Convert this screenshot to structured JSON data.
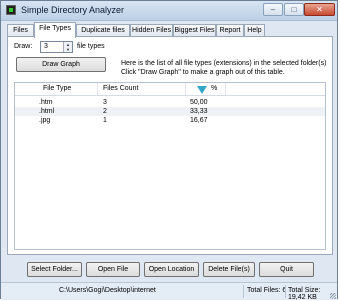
{
  "window": {
    "title": "Simple Directory Analyzer"
  },
  "titlebar_buttons": {
    "minimize": "–",
    "maximize": "□",
    "close": "✕"
  },
  "tabs": [
    {
      "label": "Files"
    },
    {
      "label": "File Types",
      "active": true
    },
    {
      "label": "Duplicate files"
    },
    {
      "label": "Hidden Files"
    },
    {
      "label": "Biggest Files"
    },
    {
      "label": "Report"
    },
    {
      "label": "Help"
    }
  ],
  "panel": {
    "draw_label": "Draw:",
    "draw_value": "3",
    "file_types_label": "file types",
    "draw_graph_button": "Draw Graph",
    "info_line1": "Here is the list of all file types (extensions) in the selected folder(s)",
    "info_line2": "Click \"Draw Graph\" to make a graph out of this table.",
    "columns": {
      "file_type": "File Type",
      "files_count": "Files Count",
      "percent": "%"
    },
    "rows": [
      {
        "type": ".htm",
        "count": "3",
        "percent": "50,00"
      },
      {
        "type": ".html",
        "count": "2",
        "percent": "33,33"
      },
      {
        "type": ".jpg",
        "count": "1",
        "percent": "16,67"
      }
    ]
  },
  "buttons": {
    "select_folder": "Select Folder...",
    "open_file": "Open File",
    "open_location": "Open Location",
    "delete_files": "Delete File(s)",
    "quit": "Quit"
  },
  "status": {
    "path": "C:\\Users\\Gogi\\Desktop\\internet",
    "total_files": "Total Files: 6",
    "total_size": "Total Size: 19,42 KB"
  },
  "colors": {
    "sort_icon": "#33a7c9",
    "selected_row": "#eef1f5"
  }
}
